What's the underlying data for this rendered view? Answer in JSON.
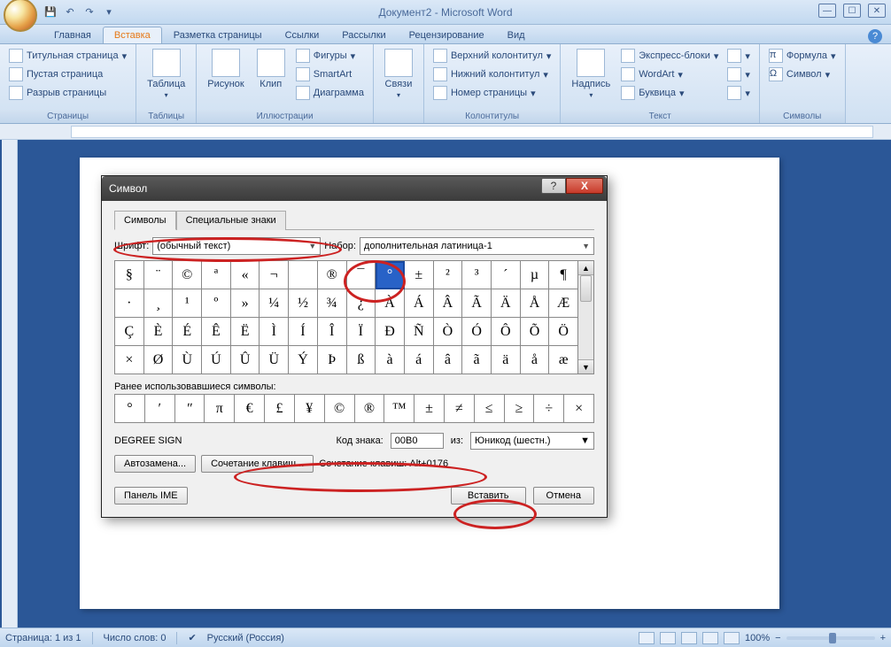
{
  "app": {
    "title": "Документ2 - Microsoft Word"
  },
  "tabs": {
    "home": "Главная",
    "insert": "Вставка",
    "pagelayout": "Разметка страницы",
    "references": "Ссылки",
    "mailings": "Рассылки",
    "review": "Рецензирование",
    "view": "Вид"
  },
  "ribbon": {
    "pages": {
      "cover": "Титульная страница",
      "blank": "Пустая страница",
      "break": "Разрыв страницы",
      "label": "Страницы"
    },
    "tables": {
      "table": "Таблица",
      "label": "Таблицы"
    },
    "illustrations": {
      "picture": "Рисунок",
      "clip": "Клип",
      "shapes": "Фигуры",
      "smartart": "SmartArt",
      "chart": "Диаграмма",
      "label": "Иллюстрации"
    },
    "links": {
      "links": "Связи"
    },
    "headerfooter": {
      "header": "Верхний колонтитул",
      "footer": "Нижний колонтитул",
      "pagenum": "Номер страницы",
      "label": "Колонтитулы"
    },
    "text": {
      "textbox": "Надпись",
      "quickparts": "Экспресс-блоки",
      "wordart": "WordArt",
      "dropcap": "Буквица",
      "label": "Текст"
    },
    "symbols": {
      "equation": "Формула",
      "symbol": "Символ",
      "label": "Символы"
    }
  },
  "statusbar": {
    "page": "Страница: 1 из 1",
    "words": "Число слов: 0",
    "lang": "Русский (Россия)",
    "zoom": "100%"
  },
  "dialog": {
    "title": "Символ",
    "tab_symbols": "Символы",
    "tab_special": "Специальные знаки",
    "font_label": "Шрифт:",
    "font_value": "(обычный текст)",
    "subset_label": "Набор:",
    "subset_value": "дополнительная латиница-1",
    "chars_row1": [
      "§",
      "¨",
      "©",
      "ª",
      "«",
      "¬",
      "­",
      "®",
      "¯",
      "°",
      "±",
      "²",
      "³",
      "´",
      "µ",
      "¶"
    ],
    "chars_row2": [
      "·",
      "¸",
      "¹",
      "º",
      "»",
      "¼",
      "½",
      "¾",
      "¿",
      "À",
      "Á",
      "Â",
      "Ã",
      "Ä",
      "Å",
      "Æ"
    ],
    "chars_row3": [
      "Ç",
      "È",
      "É",
      "Ê",
      "Ë",
      "Ì",
      "Í",
      "Î",
      "Ï",
      "Ð",
      "Ñ",
      "Ò",
      "Ó",
      "Ô",
      "Õ",
      "Ö"
    ],
    "chars_row4": [
      "×",
      "Ø",
      "Ù",
      "Ú",
      "Û",
      "Ü",
      "Ý",
      "Þ",
      "ß",
      "à",
      "á",
      "â",
      "ã",
      "ä",
      "å",
      "æ"
    ],
    "selected_index": 9,
    "recent_label": "Ранее использовавшиеся символы:",
    "recent": [
      "°",
      "ʹ",
      "ʺ",
      "π",
      "€",
      "£",
      "¥",
      "©",
      "®",
      "™",
      "±",
      "≠",
      "≤",
      "≥",
      "÷",
      "×"
    ],
    "char_name": "DEGREE SIGN",
    "code_label": "Код знака:",
    "code_value": "00B0",
    "from_label": "из:",
    "from_value": "Юникод (шестн.)",
    "autocorrect": "Автозамена...",
    "shortcut_btn": "Сочетание клавиш...",
    "shortcut_text": "Сочетание клавиш: Alt+0176",
    "ime_panel": "Панель IME",
    "insert": "Вставить",
    "cancel": "Отмена"
  }
}
